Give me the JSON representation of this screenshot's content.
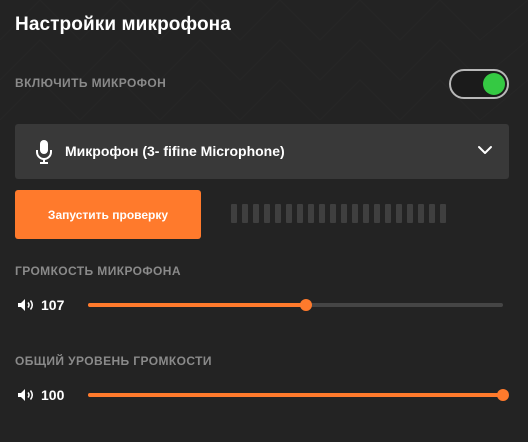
{
  "title": "Настройки микрофона",
  "enable_mic": {
    "label": "ВКЛЮЧИТЬ МИКРОФОН",
    "enabled": true
  },
  "device": {
    "icon": "microphone-icon",
    "name": "Микрофон (3- fifine Microphone)"
  },
  "test": {
    "button_label": "Запустить проверку",
    "level_bars": 20
  },
  "mic_volume": {
    "label": "ГРОМКОСТЬ МИКРОФОНА",
    "value": "107",
    "fraction": 0.526
  },
  "master_volume": {
    "label": "ОБЩИЙ УРОВЕНЬ ГРОМКОСТИ",
    "value": "100",
    "fraction": 1.0
  },
  "colors": {
    "accent": "#ff7a2c",
    "toggle_on": "#35c943",
    "background": "#232323",
    "panel": "#393939",
    "muted_text": "#8a8a8a"
  }
}
